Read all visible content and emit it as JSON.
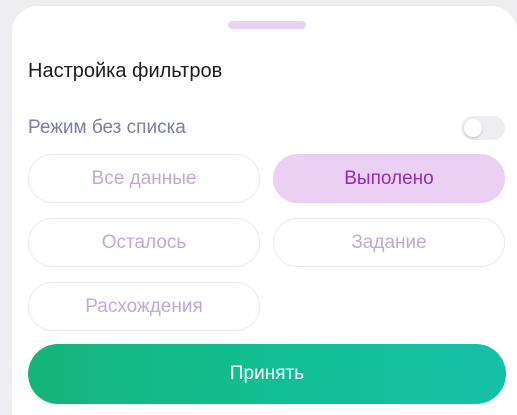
{
  "sheet": {
    "title": "Настройка фильтров",
    "list_mode": {
      "label": "Режим без списка",
      "enabled": false
    },
    "filters": [
      {
        "label": "Все данные",
        "selected": false
      },
      {
        "label": "Выполено",
        "selected": true
      },
      {
        "label": "Осталось",
        "selected": false
      },
      {
        "label": "Задание",
        "selected": false
      },
      {
        "label": "Расхождения",
        "selected": false
      }
    ],
    "accept_label": "Принять"
  },
  "colors": {
    "accent": "#8d2fb0",
    "chip_selected_bg": "#ebd0f3",
    "chip_text": "#c3a7dc",
    "button_gradient_start": "#16b47c",
    "button_gradient_end": "#16c0a8",
    "handle": "#e8d3f4"
  }
}
